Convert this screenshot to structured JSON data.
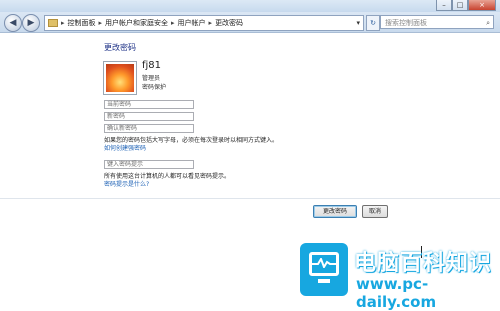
{
  "window": {
    "minimize_glyph": "–",
    "maximize_glyph": "□",
    "close_glyph": "×"
  },
  "navbar": {
    "back_glyph": "◀",
    "forward_glyph": "▶",
    "breadcrumbs": [
      "控制面板",
      "用户帐户和家庭安全",
      "用户帐户",
      "更改密码"
    ],
    "separator": "▸",
    "dropdown_glyph": "▾",
    "refresh_glyph": "↻",
    "search_placeholder": "搜索控制面板",
    "search_glyph": "⌕"
  },
  "main": {
    "heading": "更改密码",
    "user": {
      "name": "fj81",
      "type": "管理员",
      "password_status": "密码保护"
    },
    "fields": {
      "current_password_placeholder": "当前密码",
      "new_password_placeholder": "新密码",
      "confirm_password_placeholder": "确认新密码",
      "hint_placeholder": "键入密码提示"
    },
    "case_note": "如果您的密码包括大写字母，必须在每次登录时以相同方式键入。",
    "strong_password_link": "如何创建强密码",
    "hint_note": "所有使用这台计算机的人都可以看见密码提示。",
    "what_is_hint_link": "密码提示是什么?"
  },
  "buttons": {
    "change_password": "更改密码",
    "cancel": "取消"
  },
  "watermark": {
    "title": "电脑百科知识",
    "url": "www.pc-daily.com"
  },
  "colors": {
    "link": "#1a5fb4",
    "heading": "#1e3287",
    "watermark_blue": "#17a7e0"
  }
}
